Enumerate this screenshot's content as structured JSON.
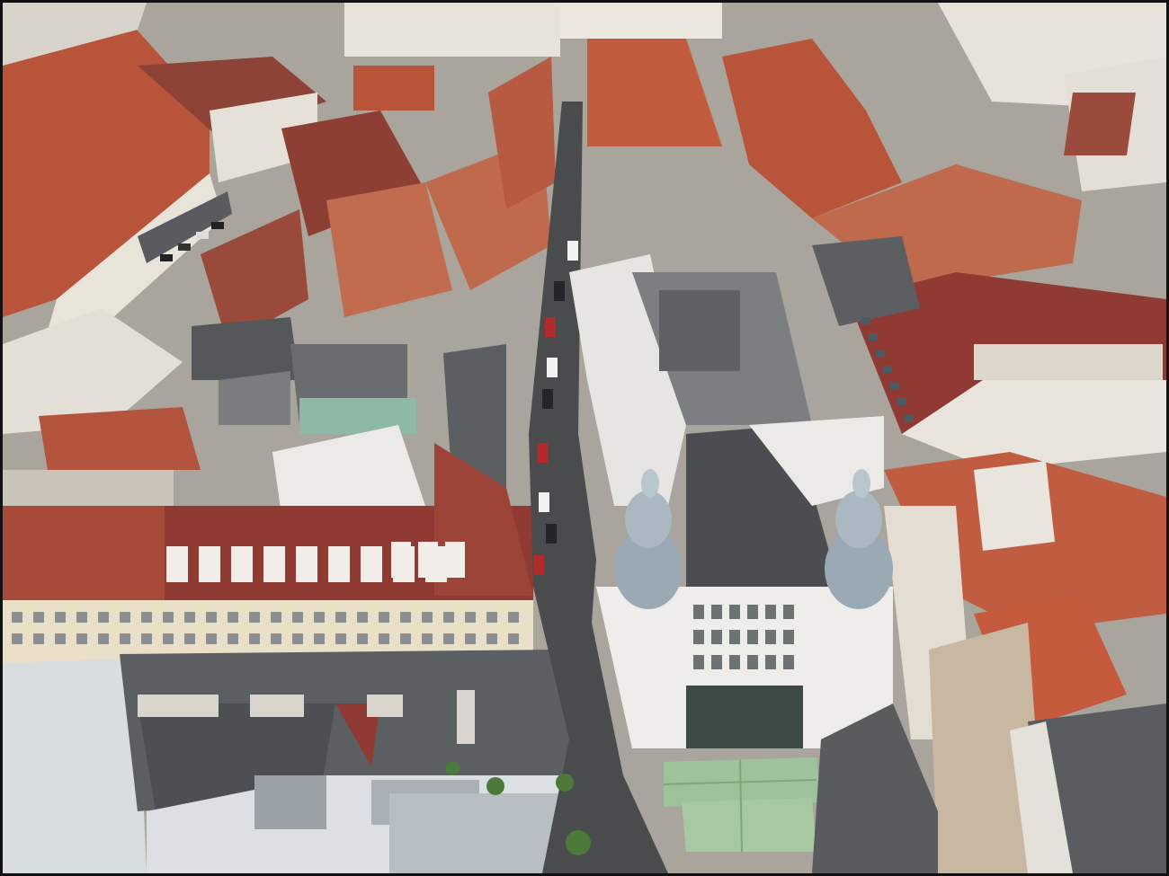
{
  "image": {
    "subject": "aerial-city-view",
    "palette": {
      "roof_red": "#b8543a",
      "roof_dark_red": "#8f3a32",
      "roof_grey": "#5b5d60",
      "facade_light": "#e9e4da",
      "facade_cream": "#eadfc7",
      "copper_green": "#8fb9a4",
      "street": "#4a4b4d",
      "awning": "#9ec39a",
      "dome": "#9aaab4",
      "frame_border": "#111111"
    }
  }
}
